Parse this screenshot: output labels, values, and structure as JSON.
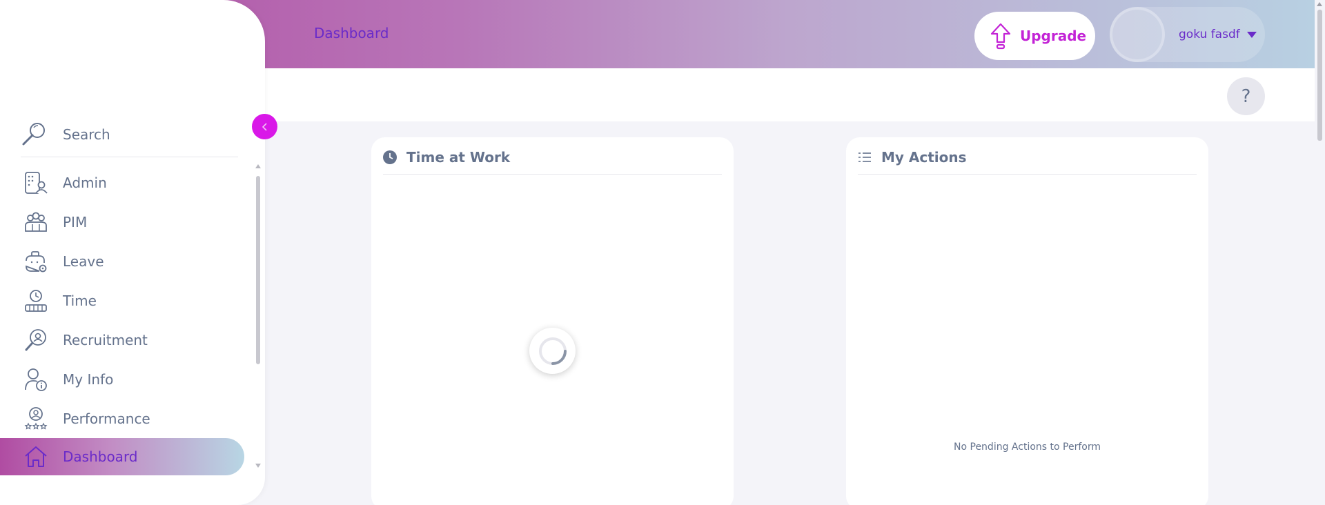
{
  "header": {
    "breadcrumb": "Dashboard",
    "upgrade_label": "Upgrade",
    "user_name": "goku fasdf",
    "help_label": "?"
  },
  "sidebar": {
    "search_placeholder": "Search",
    "items": [
      {
        "label": "Admin",
        "icon": "admin-icon"
      },
      {
        "label": "PIM",
        "icon": "pim-icon"
      },
      {
        "label": "Leave",
        "icon": "leave-icon"
      },
      {
        "label": "Time",
        "icon": "time-icon"
      },
      {
        "label": "Recruitment",
        "icon": "recruitment-icon"
      },
      {
        "label": "My Info",
        "icon": "my-info-icon"
      },
      {
        "label": "Performance",
        "icon": "performance-icon"
      },
      {
        "label": "Dashboard",
        "icon": "dashboard-icon",
        "active": true
      }
    ]
  },
  "cards": {
    "time_at_work": {
      "title": "Time at Work"
    },
    "my_actions": {
      "title": "My Actions",
      "empty_text": "No Pending Actions to Perform"
    }
  },
  "colors": {
    "accent": "#d918e8",
    "brand_purple": "#6a2bc9",
    "text_gray": "#64728c"
  }
}
